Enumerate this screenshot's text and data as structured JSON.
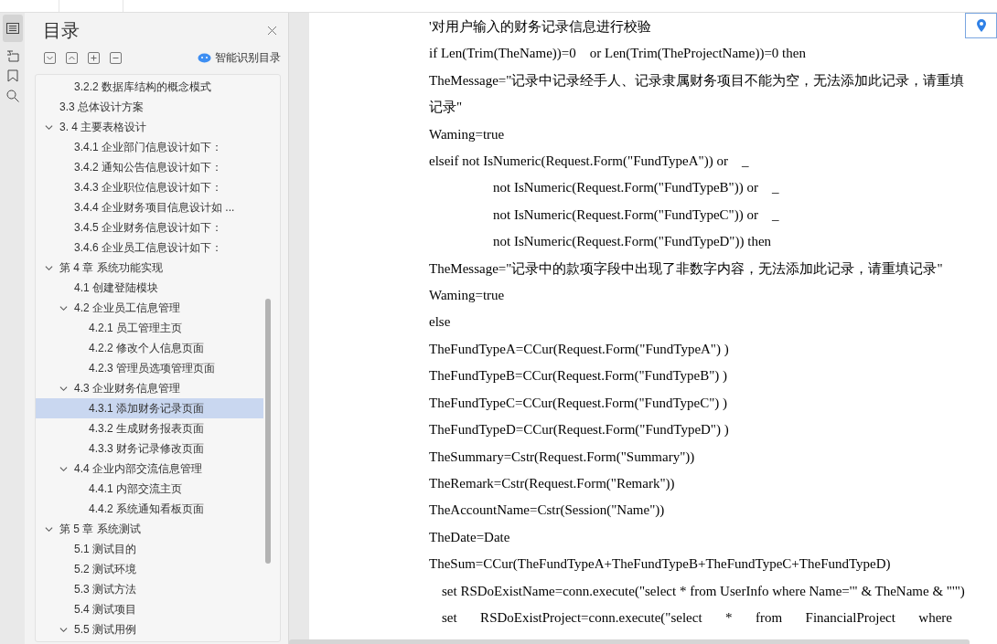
{
  "toc": {
    "title": "目录",
    "smart_label": "智能识别目录",
    "items": [
      {
        "children": [
          {
            "children": [
              {
                "label": "3.2.2  数据库结构的概念模式",
                "selected": false
              }
            ]
          },
          {
            "label": "3.3  总体设计方案",
            "selected": false
          },
          {
            "label": "3. 4  主要表格设计",
            "selected": false,
            "expanded": true,
            "children": [
              {
                "label": "3.4.1  企业部门信息设计如下：",
                "selected": false
              },
              {
                "label": "3.4.2  通知公告信息设计如下：",
                "selected": false
              },
              {
                "label": "3.4.3  企业职位信息设计如下：",
                "selected": false
              },
              {
                "label": "3.4.4  企业财务项目信息设计如 ...",
                "selected": false
              },
              {
                "label": "3.4.5  企业财务信息设计如下：",
                "selected": false
              },
              {
                "label": "3.4.6  企业员工信息设计如下：",
                "selected": false
              }
            ]
          }
        ]
      },
      {
        "label": "第 4 章  系统功能实现",
        "selected": false,
        "expanded": true,
        "children": [
          {
            "label": "4.1  创建登陆模块",
            "selected": false
          },
          {
            "label": "4.2  企业员工信息管理",
            "selected": false,
            "expanded": true,
            "children": [
              {
                "label": "4.2.1  员工管理主页",
                "selected": false
              },
              {
                "label": "4.2.2  修改个人信息页面",
                "selected": false
              },
              {
                "label": "4.2.3  管理员选项管理页面",
                "selected": false
              }
            ]
          },
          {
            "label": "4.3  企业财务信息管理",
            "selected": false,
            "expanded": true,
            "children": [
              {
                "label": "4.3.1  添加财务记录页面",
                "selected": true
              },
              {
                "label": "4.3.2  生成财务报表页面",
                "selected": false
              },
              {
                "label": "4.3.3  财务记录修改页面",
                "selected": false
              }
            ]
          },
          {
            "label": "4.4  企业内部交流信息管理",
            "selected": false,
            "expanded": true,
            "children": [
              {
                "label": "4.4.1  内部交流主页",
                "selected": false
              },
              {
                "label": "4.4.2  系统通知看板页面",
                "selected": false
              }
            ]
          }
        ]
      },
      {
        "label": "第 5 章  系统测试",
        "selected": false,
        "expanded": true,
        "children": [
          {
            "label": "5.1  测试目的",
            "selected": false
          },
          {
            "label": "5.2  测试环境",
            "selected": false
          },
          {
            "label": "5.3  测试方法",
            "selected": false
          },
          {
            "label": "5.4  测试项目",
            "selected": false
          },
          {
            "label": "5.5  测试用例",
            "selected": false,
            "expanded": true
          }
        ]
      }
    ]
  },
  "document": {
    "lines": [
      {
        "kind": "plain",
        "text": "'对用户输入的财务记录信息进行校验"
      },
      {
        "kind": "plain",
        "text": "if Len(Trim(TheName))=0    or Len(Trim(TheProjectName))=0 then"
      },
      {
        "kind": "plain",
        "text": "TheMessage=\"记录中记录经手人、记录隶属财务项目不能为空，无法添加此记录，请重填记录\""
      },
      {
        "kind": "plain",
        "text": "Waming=true"
      },
      {
        "kind": "plain",
        "text": "elseif not IsNumeric(Request.Form(\"FundTypeA\")) or    _"
      },
      {
        "kind": "indented",
        "text": "not IsNumeric(Request.Form(\"FundTypeB\")) or    _"
      },
      {
        "kind": "indented",
        "text": "not IsNumeric(Request.Form(\"FundTypeC\")) or    _"
      },
      {
        "kind": "indented",
        "text": "not IsNumeric(Request.Form(\"FundTypeD\")) then"
      },
      {
        "kind": "plain",
        "text": "TheMessage=\"记录中的款项字段中出现了非数字内容，无法添加此记录，请重填记录\""
      },
      {
        "kind": "plain",
        "text": "Waming=true"
      },
      {
        "kind": "plain",
        "text": "else"
      },
      {
        "kind": "plain",
        "text": "TheFundTypeA=CCur(Request.Form(\"FundTypeA\") )"
      },
      {
        "kind": "plain",
        "text": "TheFundTypeB=CCur(Request.Form(\"FundTypeB\") )"
      },
      {
        "kind": "plain",
        "text": "TheFundTypeC=CCur(Request.Form(\"FundTypeC\") )"
      },
      {
        "kind": "plain",
        "text": "TheFundTypeD=CCur(Request.Form(\"FundTypeD\") )"
      },
      {
        "kind": "plain",
        "text": "TheSummary=Cstr(Request.Form(\"Summary\"))"
      },
      {
        "kind": "plain",
        "text": "TheRemark=Cstr(Request.Form(\"Remark\"))"
      },
      {
        "kind": "plain",
        "text": "TheAccountName=Cstr(Session(\"Name\"))"
      },
      {
        "kind": "plain",
        "text": "TheDate=Date"
      },
      {
        "kind": "plain",
        "text": "TheSum=CCur(TheFundTypeA+TheFundTypeB+TheFundTypeC+TheFundTypeD)"
      },
      {
        "kind": "set",
        "text": "set RSDoExistName=conn.execute(\"select * from UserInfo where Name='\" & TheName & \"'\")"
      },
      {
        "kind": "justified",
        "text": "set RSDoExistProject=conn.execute(\"select * from FinancialProject where"
      }
    ]
  }
}
